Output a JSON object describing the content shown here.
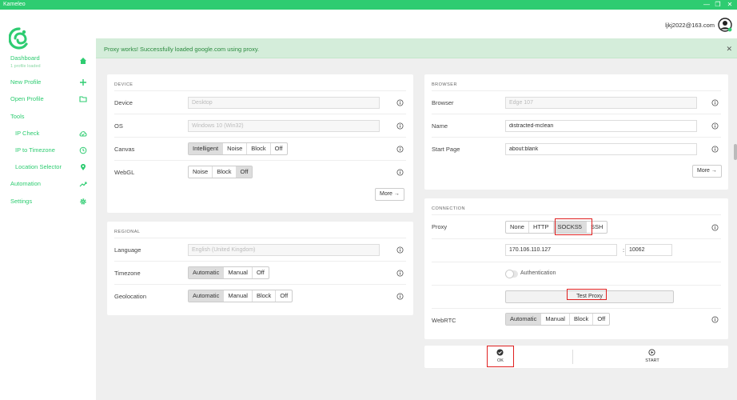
{
  "window": {
    "title": "Kameleo",
    "minimize": "—",
    "maximize": "❐",
    "close": "✕"
  },
  "sidebar": {
    "dashboard": {
      "label": "Dashboard",
      "sub": "1 profile loaded"
    },
    "new_profile": "New Profile",
    "open_profile": "Open Profile",
    "tools": "Tools",
    "ip_check": "IP Check",
    "ip_to_timezone": "IP to Timezone",
    "location_selector": "Location Selector",
    "automation": "Automation",
    "settings": "Settings"
  },
  "header": {
    "user_email": "ljkj2022@163.com"
  },
  "alert": {
    "message": "Proxy works! Successfully loaded google.com using proxy.",
    "close": "✕"
  },
  "device": {
    "title": "DEVICE",
    "device_label": "Device",
    "device_value": "Desktop",
    "os_label": "OS",
    "os_value": "Windows 10 (Win32)",
    "canvas_label": "Canvas",
    "canvas_options": [
      "Intelligent",
      "Noise",
      "Block",
      "Off"
    ],
    "canvas_selected": "Intelligent",
    "webgl_label": "WebGL",
    "webgl_options": [
      "Noise",
      "Block",
      "Off"
    ],
    "webgl_selected": "Off",
    "more": "More"
  },
  "regional": {
    "title": "REGIONAL",
    "language_label": "Language",
    "language_value": "English (United Kingdom)",
    "timezone_label": "Timezone",
    "timezone_options": [
      "Automatic",
      "Manual",
      "Off"
    ],
    "timezone_selected": "Automatic",
    "geolocation_label": "Geolocation",
    "geolocation_options": [
      "Automatic",
      "Manual",
      "Block",
      "Off"
    ],
    "geolocation_selected": "Automatic"
  },
  "browser": {
    "title": "BROWSER",
    "browser_label": "Browser",
    "browser_value": "Edge 107",
    "name_label": "Name",
    "name_value": "distracted-mclean",
    "start_page_label": "Start Page",
    "start_page_value": "about:blank",
    "more": "More"
  },
  "connection": {
    "title": "CONNECTION",
    "proxy_label": "Proxy",
    "proxy_options": [
      "None",
      "HTTP",
      "SOCKS5",
      "SSH"
    ],
    "proxy_selected": "SOCKS5",
    "host": "170.106.110.127",
    "separator": ":",
    "port": "10062",
    "authentication": "Authentication",
    "test_proxy": "Test Proxy",
    "webrtc_label": "WebRTC",
    "webrtc_options": [
      "Automatic",
      "Manual",
      "Block",
      "Off"
    ],
    "webrtc_selected": "Automatic"
  },
  "actions": {
    "ok": "OK",
    "start": "START"
  },
  "colors": {
    "accent": "#2ecc71",
    "alert_bg": "#d4edda",
    "highlight": "#e02020"
  }
}
